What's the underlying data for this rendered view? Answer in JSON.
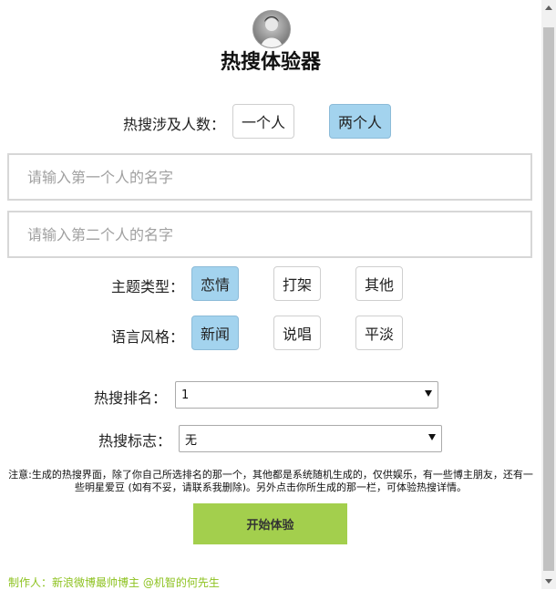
{
  "header": {
    "title": "热搜体验器",
    "avatar_icon": "user-avatar"
  },
  "people_count": {
    "label": "热搜涉及人数：",
    "options": [
      "一个人",
      "两个人"
    ],
    "selected": 1
  },
  "inputs": {
    "first_placeholder": "请输入第一个人的名字",
    "second_placeholder": "请输入第二个人的名字"
  },
  "topic_type": {
    "label": "主题类型：",
    "options": [
      "恋情",
      "打架",
      "其他"
    ],
    "selected": 0
  },
  "language_style": {
    "label": "语言风格：",
    "options": [
      "新闻",
      "说唱",
      "平淡"
    ],
    "selected": 0
  },
  "rank": {
    "label": "热搜排名：",
    "value": "1"
  },
  "badge": {
    "label": "热搜标志：",
    "value": "无"
  },
  "note": "注意:生成的热搜界面，除了你自己所选排名的那一个，其他都是系统随机生成的，仅供娱乐，有一些博主朋友，还有一些明星爱豆 (如有不妥，请联系我删除)。另外点击你所生成的那一栏，可体验热搜详情。",
  "start_button": "开始体验",
  "footer": "制作人：新浪微博最帅博主 @机智的何先生",
  "colors": {
    "selected": "#a3d3ee",
    "start": "#a3cf4d",
    "footer": "#8dc21f"
  }
}
